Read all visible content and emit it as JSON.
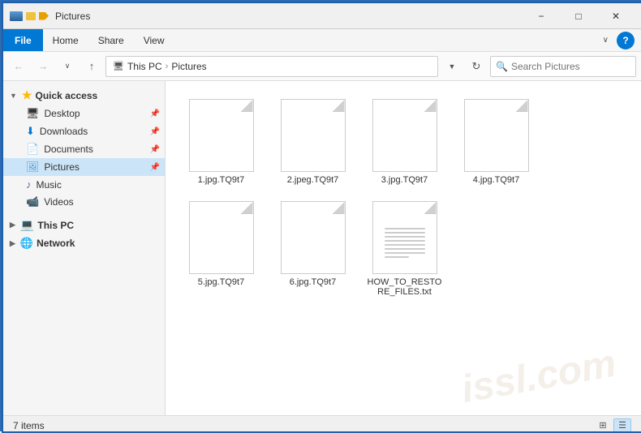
{
  "titleBar": {
    "title": "Pictures",
    "minimize": "−",
    "maximize": "□",
    "close": "✕"
  },
  "menuBar": {
    "file": "File",
    "home": "Home",
    "share": "Share",
    "view": "View",
    "chevron": "∨",
    "help": "?"
  },
  "toolbar": {
    "back": "←",
    "forward": "→",
    "up": "↑",
    "recent": "∨",
    "addressParts": [
      "This PC",
      "Pictures"
    ],
    "addressDropdown": "∨",
    "refresh": "↻",
    "searchPlaceholder": "Search Pictures"
  },
  "sidebar": {
    "quickAccess": {
      "label": "Quick access",
      "chevron": "▼"
    },
    "items": [
      {
        "id": "desktop",
        "label": "Desktop",
        "icon": "desktop",
        "pinned": true
      },
      {
        "id": "downloads",
        "label": "Downloads",
        "icon": "download",
        "pinned": true
      },
      {
        "id": "documents",
        "label": "Documents",
        "icon": "document",
        "pinned": true
      },
      {
        "id": "pictures",
        "label": "Pictures",
        "icon": "picture",
        "pinned": true,
        "active": true
      }
    ],
    "extra": [
      {
        "id": "music",
        "label": "Music",
        "icon": "music"
      },
      {
        "id": "videos",
        "label": "Videos",
        "icon": "video"
      }
    ],
    "thisPC": {
      "label": "This PC",
      "icon": "pc"
    },
    "network": {
      "label": "Network",
      "icon": "network"
    }
  },
  "files": [
    {
      "id": "file1",
      "name": "1.jpg.TQ9t7",
      "type": "generic"
    },
    {
      "id": "file2",
      "name": "2.jpeg.TQ9t7",
      "type": "generic"
    },
    {
      "id": "file3",
      "name": "3.jpg.TQ9t7",
      "type": "generic"
    },
    {
      "id": "file4",
      "name": "4.jpg.TQ9t7",
      "type": "generic"
    },
    {
      "id": "file5",
      "name": "5.jpg.TQ9t7",
      "type": "generic"
    },
    {
      "id": "file6",
      "name": "6.jpg.TQ9t7",
      "type": "generic"
    },
    {
      "id": "file7",
      "name": "HOW_TO_RESTORE_FILES.txt",
      "type": "text"
    }
  ],
  "statusBar": {
    "count": "7 items",
    "viewGrid": "⊞",
    "viewList": "☰"
  },
  "watermark": "issl.com"
}
